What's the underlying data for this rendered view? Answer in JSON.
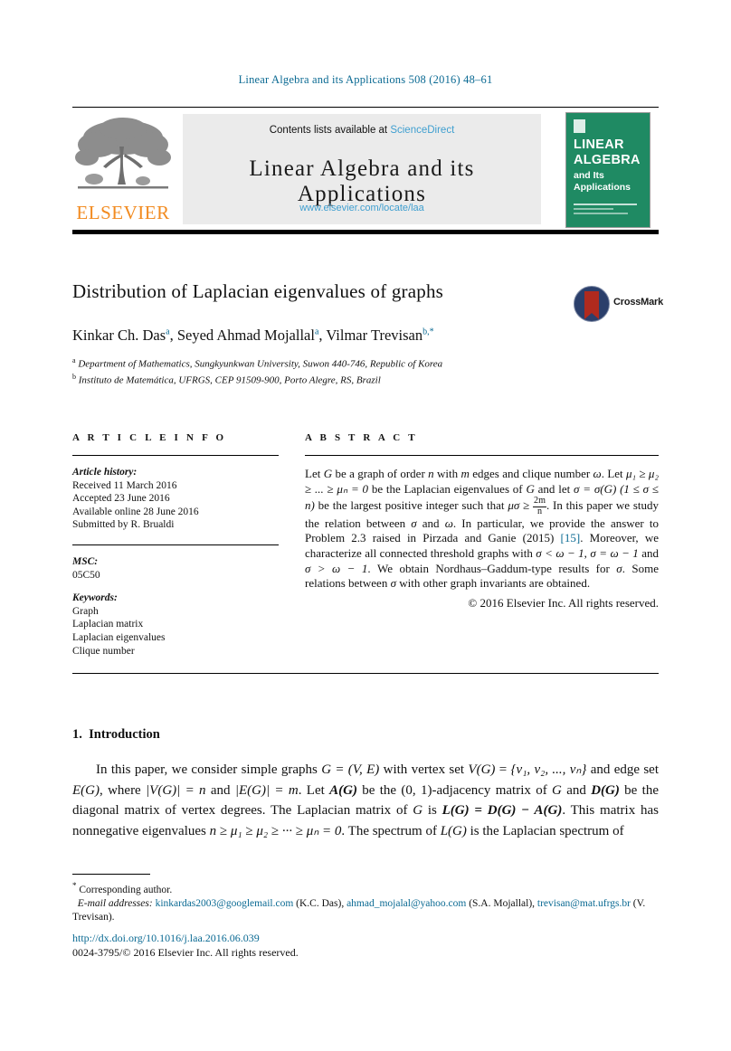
{
  "running_head": "Linear Algebra and its Applications 508 (2016) 48–61",
  "masthead": {
    "contents_prefix": "Contents lists available at ",
    "sciencedirect": "ScienceDirect",
    "journal_title": "Linear Algebra and its Applications",
    "journal_url": "www.elsevier.com/locate/laa",
    "publisher": "ELSEVIER",
    "cover": {
      "line1": "LINEAR",
      "line2": "ALGEBRA",
      "line3": "and Its",
      "line4": "Applications"
    }
  },
  "article": {
    "title": "Distribution of Laplacian eigenvalues of graphs",
    "crossmark_label": "CrossMark",
    "authors": [
      {
        "name": "Kinkar Ch. Das",
        "marks": "a",
        "sep": ", "
      },
      {
        "name": "Seyed Ahmad Mojallal",
        "marks": "a",
        "sep": ", "
      },
      {
        "name": "Vilmar Trevisan",
        "marks": "b,*",
        "sep": ""
      }
    ],
    "affiliations": [
      {
        "mark": "a",
        "text": "Department of Mathematics, Sungkyunkwan University, Suwon 440-746, Republic of Korea"
      },
      {
        "mark": "b",
        "text": "Instituto de Matemática, UFRGS, CEP 91509-900, Porto Alegre, RS, Brazil"
      }
    ]
  },
  "info": {
    "heading": "A R T I C L E   I N F O",
    "history_label": "Article history:",
    "history": [
      "Received 11 March 2016",
      "Accepted 23 June 2016",
      "Available online 28 June 2016",
      "Submitted by R. Brualdi"
    ],
    "msc_label": "MSC:",
    "msc": "05C50",
    "keywords_label": "Keywords:",
    "keywords": [
      "Graph",
      "Laplacian matrix",
      "Laplacian eigenvalues",
      "Clique number"
    ]
  },
  "abstract": {
    "heading": "A B S T R A C T",
    "p1_a": "Let ",
    "p1_G": "G",
    "p1_b": " be a graph of order ",
    "p1_n": "n",
    "p1_c": " with ",
    "p1_m": "m",
    "p1_d": " edges and clique number ",
    "p1_w": "ω",
    "p1_e": ". Let ",
    "p1_eig": "μ₁ ≥ μ₂ ≥ ... ≥ μₙ = 0",
    "p1_f": " be the Laplacian eigenvalues of ",
    "p1_g": " and let ",
    "p1_sigma": "σ = σ(G)",
    "p1_range": "(1 ≤ σ ≤ n)",
    "p1_h": " be the largest positive integer such that ",
    "p1_mu_sigma": "μσ",
    "p1_geq": " ≥ ",
    "frac_num": "2m",
    "frac_den": "n",
    "p1_i": ". In this paper we study the relation between ",
    "p1_j": " and ",
    "p1_k": ". In particular, we provide the answer to Problem 2.3 raised in Pirzada and Ganie (2015) ",
    "citation": "[15]",
    "p1_l": ". Moreover, we characterize all connected threshold graphs with ",
    "p1_cond1": "σ < ω − 1",
    "p1_cond2": "σ = ω − 1",
    "p1_cond3": "σ > ω − 1",
    "p1_m2": ". We obtain Nordhaus–Gaddum-type results for ",
    "p1_n2": ". Some relations between ",
    "p1_o": " with other graph invariants are obtained.",
    "copyright": "© 2016 Elsevier Inc. All rights reserved."
  },
  "body": {
    "section_number": "1.",
    "section_title": "Introduction",
    "paragraph": {
      "t1": "In this paper, we consider simple graphs ",
      "t2": " with vertex set ",
      "t3": " and edge set ",
      "t4": ", where ",
      "t5": " and ",
      "t6": ". Let ",
      "t7": " be the (0, 1)-adjacency matrix of ",
      "t8": " and ",
      "t9": " be the diagonal matrix of vertex degrees. The Laplacian matrix of ",
      "t10": " is ",
      "t11": ". This matrix has nonnegative eigenvalues ",
      "t12": ". The spectrum of ",
      "t13": " is the Laplacian spectrum of",
      "G": "G",
      "GVE": "G = (V, E)",
      "VG": "V(G)",
      "vertexset": "{v₁, v₂, ..., vₙ}",
      "EG": "E(G)",
      "cardV": "|V(G)| = n",
      "cardE": "|E(G)| = m",
      "AG": "A(G)",
      "DG": "D(G)",
      "LG": "L(G) = D(G) − A(G)",
      "eigchain": "n ≥ μ₁ ≥ μ₂ ≥ ··· ≥ μₙ = 0",
      "LGspec": "L(G)"
    }
  },
  "footnote": {
    "corresponding_mark": "*",
    "corresponding": "Corresponding author.",
    "email_label": "E-mail addresses:",
    "emails": [
      {
        "address": "kinkardas2003@googlemail.com",
        "owner": "(K.C. Das)"
      },
      {
        "address": "ahmad_mojalal@yahoo.com",
        "owner": "(S.A. Mojallal)"
      },
      {
        "address": "trevisan@mat.ufrgs.br",
        "owner": "(V. Trevisan)"
      }
    ],
    "doi": "http://dx.doi.org/10.1016/j.laa.2016.06.039",
    "issn": "0024-3795/© 2016 Elsevier Inc. All rights reserved."
  },
  "colors": {
    "link": "#0b6a93",
    "sciencedirect": "#3f9fd0",
    "elsevier_orange": "#f28b20",
    "cover_green": "#1f8a63",
    "crossmark_blue": "#2b3f6b",
    "crossmark_red": "#b02a1e"
  }
}
